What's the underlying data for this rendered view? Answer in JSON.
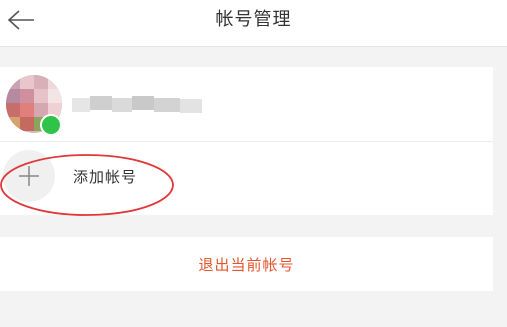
{
  "header": {
    "title": "帐号管理"
  },
  "accounts": {
    "add_label": "添加帐号"
  },
  "actions": {
    "logout_label": "退出当前帐号"
  },
  "colors": {
    "logout_text": "#e4542d",
    "annotation_circle": "#e0373a",
    "background": "#f3f3f3"
  },
  "icons": {
    "back": "back-arrow-icon",
    "add": "plus-icon"
  }
}
